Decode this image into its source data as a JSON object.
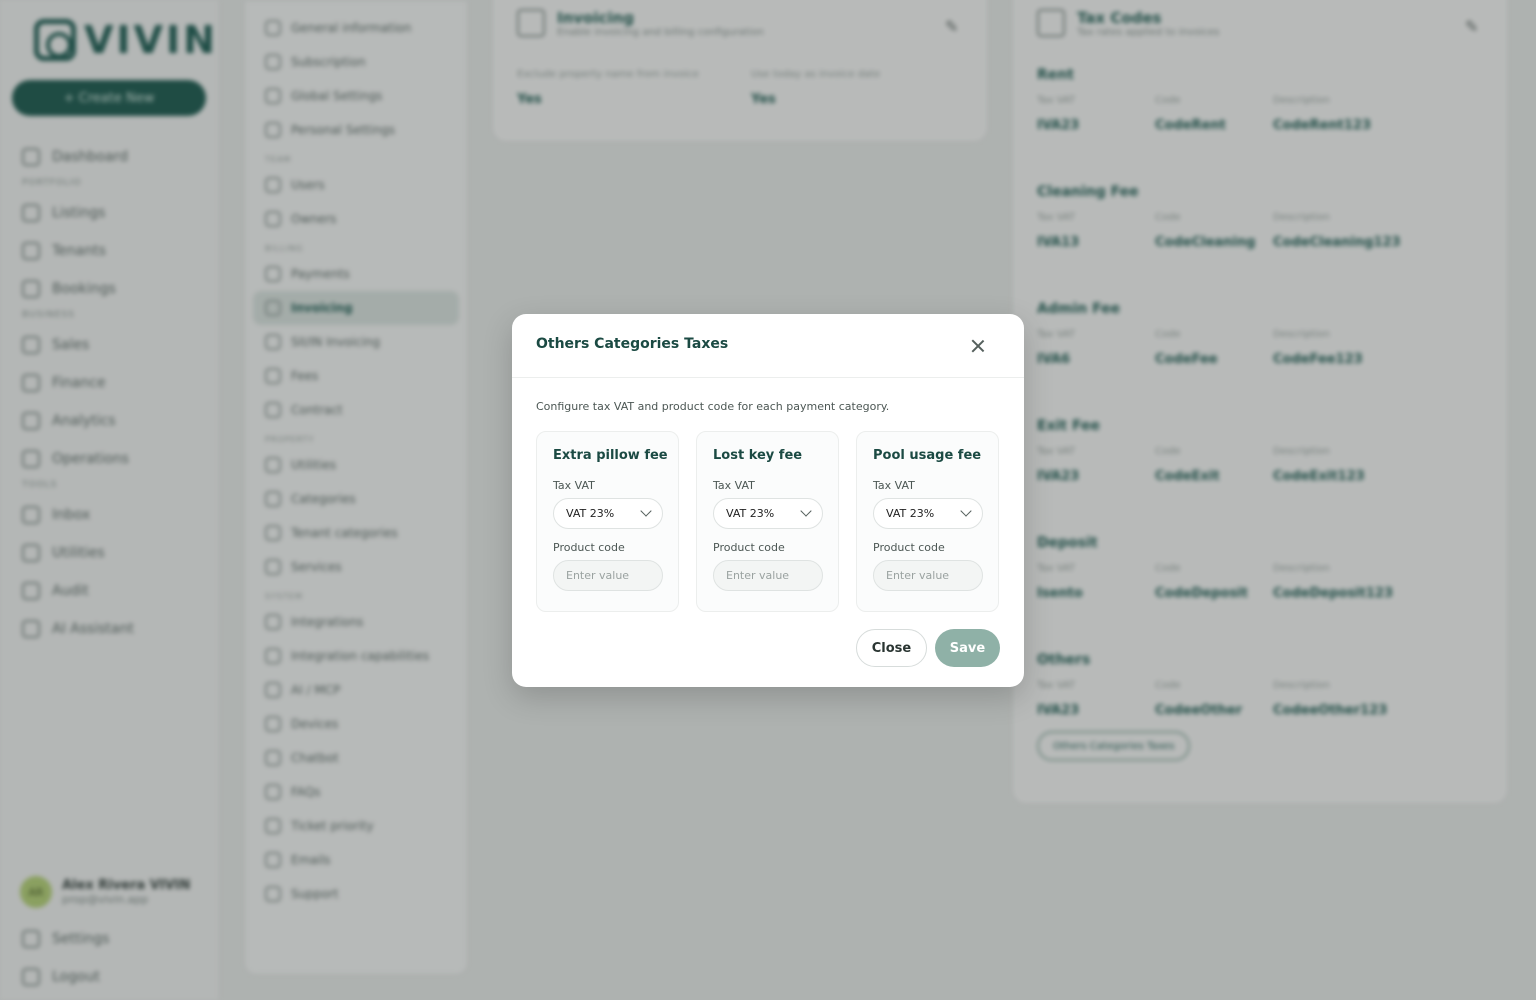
{
  "app": {
    "logo_text": "VIVIN",
    "create_label": "+ Create New",
    "nav": [
      {
        "type": "item",
        "label": "Dashboard"
      },
      {
        "type": "section",
        "label": "PORTFOLIO"
      },
      {
        "type": "item",
        "label": "Listings"
      },
      {
        "type": "item",
        "label": "Tenants"
      },
      {
        "type": "item",
        "label": "Bookings"
      },
      {
        "type": "section",
        "label": "BUSINESS"
      },
      {
        "type": "item",
        "label": "Sales"
      },
      {
        "type": "item",
        "label": "Finance"
      },
      {
        "type": "item",
        "label": "Analytics"
      },
      {
        "type": "item",
        "label": "Operations"
      },
      {
        "type": "section",
        "label": "TOOLS"
      },
      {
        "type": "item",
        "label": "Inbox"
      },
      {
        "type": "item",
        "label": "Utilities"
      },
      {
        "type": "item",
        "label": "Audit"
      },
      {
        "type": "item",
        "label": "AI Assistant"
      }
    ],
    "user": {
      "initials": "AR",
      "name": "Alex Rivera VIVIN",
      "email": "prop@vivin.app"
    },
    "bottom_nav": [
      "Settings",
      "Logout"
    ]
  },
  "settings_nav": [
    {
      "type": "item",
      "label": "General information"
    },
    {
      "type": "item",
      "label": "Subscription"
    },
    {
      "type": "item",
      "label": "Global Settings"
    },
    {
      "type": "item",
      "label": "Personal Settings"
    },
    {
      "type": "section",
      "label": "TEAM"
    },
    {
      "type": "item",
      "label": "Users"
    },
    {
      "type": "item",
      "label": "Owners"
    },
    {
      "type": "section",
      "label": "BILLING"
    },
    {
      "type": "item",
      "label": "Payments"
    },
    {
      "type": "item",
      "label": "Invoicing",
      "active": true
    },
    {
      "type": "item",
      "label": "SII/IN Invoicing"
    },
    {
      "type": "item",
      "label": "Fees"
    },
    {
      "type": "item",
      "label": "Contract"
    },
    {
      "type": "section",
      "label": "PROPERTY"
    },
    {
      "type": "item",
      "label": "Utilities"
    },
    {
      "type": "item",
      "label": "Categories"
    },
    {
      "type": "item",
      "label": "Tenant categories"
    },
    {
      "type": "item",
      "label": "Services"
    },
    {
      "type": "section",
      "label": "SYSTEM"
    },
    {
      "type": "item",
      "label": "Integrations"
    },
    {
      "type": "item",
      "label": "Integration capabilities"
    },
    {
      "type": "item",
      "label": "AI / MCP"
    },
    {
      "type": "item",
      "label": "Devices"
    },
    {
      "type": "item",
      "label": "Chatbot"
    },
    {
      "type": "item",
      "label": "FAQs"
    },
    {
      "type": "item",
      "label": "Ticket priority"
    },
    {
      "type": "item",
      "label": "Emails"
    },
    {
      "type": "item",
      "label": "Support"
    }
  ],
  "invoicing_card": {
    "title": "Invoicing",
    "subtitle": "Enable invoicing and billing configuration",
    "fields": [
      {
        "label": "Exclude property name from invoice",
        "value": "Yes"
      },
      {
        "label": "Use today as invoice date",
        "value": "Yes"
      }
    ]
  },
  "tax_codes_card": {
    "title": "Tax Codes",
    "subtitle": "Tax rates applied to invoices",
    "col_labels": [
      "Tax VAT",
      "Code",
      "Description"
    ],
    "blocks": [
      {
        "name": "Rent",
        "vat": "IVA23",
        "code": "CodeRent",
        "description": "CodeRent123"
      },
      {
        "name": "Cleaning Fee",
        "vat": "IVA13",
        "code": "CodeCleaning",
        "description": "CodeCleaning123"
      },
      {
        "name": "Admin Fee",
        "vat": "IVA6",
        "code": "CodeFee",
        "description": "CodeFee123"
      },
      {
        "name": "Exit Fee",
        "vat": "IVA23",
        "code": "CodeExit",
        "description": "CodeExit123"
      },
      {
        "name": "Deposit",
        "vat": "Isento",
        "code": "CodeDeposit",
        "description": "CodeDeposit123"
      },
      {
        "name": "Others",
        "vat": "IVA23",
        "code": "CodeeOther",
        "description": "CodeeOther123"
      }
    ],
    "others_button": "Others Categories Taxes"
  },
  "modal": {
    "title": "Others Categories Taxes",
    "description": "Configure tax VAT and product code for each payment category.",
    "categories": [
      {
        "name": "Extra pillow fee",
        "tax_label": "Tax VAT",
        "tax_value": "VAT 23%",
        "code_label": "Product code",
        "code_value": "",
        "code_placeholder": "Enter value"
      },
      {
        "name": "Lost key fee",
        "tax_label": "Tax VAT",
        "tax_value": "VAT 23%",
        "code_label": "Product code",
        "code_value": "",
        "code_placeholder": "Enter value"
      },
      {
        "name": "Pool usage fee",
        "tax_label": "Tax VAT",
        "tax_value": "VAT 23%",
        "code_label": "Product code",
        "code_value": "",
        "code_placeholder": "Enter value"
      }
    ],
    "close_label": "Close",
    "save_label": "Save"
  },
  "colors": {
    "brand": "#1e5e55",
    "save_button": "#8fb1a7",
    "overlay": "rgba(40,46,44,0.32)"
  }
}
